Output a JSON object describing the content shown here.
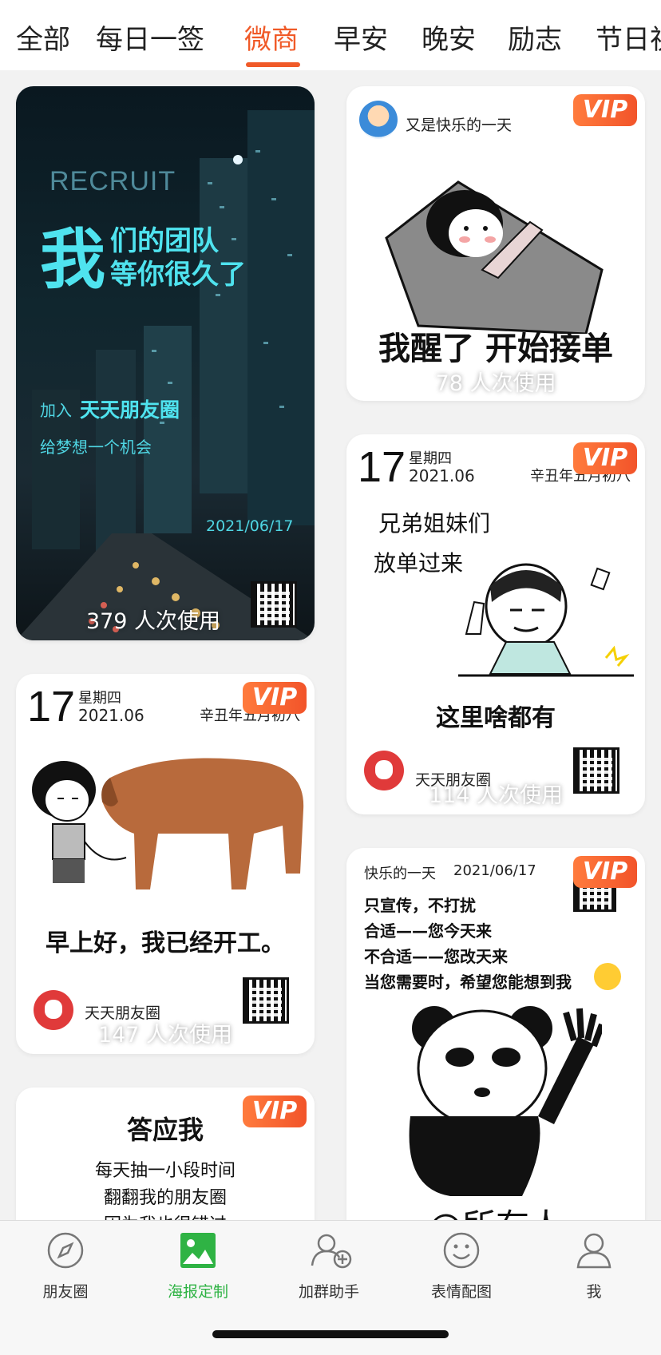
{
  "tabs": [
    "全部",
    "每日一签",
    "微商",
    "早安",
    "晚安",
    "励志",
    "节日祝"
  ],
  "active_tab_index": 2,
  "colors": {
    "accent": "#f05a28",
    "nav_active": "#2fb344",
    "vip": "#f2542a"
  },
  "cards": {
    "recruit": {
      "eyebrow": "RECRUIT",
      "headline_big": "我",
      "headline_line1": "们的团队",
      "headline_line2": "等你很久了",
      "join_prefix": "加入",
      "join_brand": "天天朋友圈",
      "tagline": "给梦想一个机会",
      "date": "2021/06/17",
      "usage": "379 人次使用"
    },
    "wakeup": {
      "vip": "VIP",
      "caption_top": "又是快乐的一天",
      "caption": "我醒了 开始接单",
      "usage": "78 人次使用"
    },
    "siblings": {
      "vip": "VIP",
      "day": "17",
      "weekday": "星期四",
      "month": "2021.06",
      "lunar": "辛丑年五月初八",
      "line1": "兄弟姐妹们",
      "line2": "放单过来",
      "caption": "这里啥都有",
      "brand": "天天朋友圈",
      "usage": "114 人次使用"
    },
    "cow": {
      "vip": "VIP",
      "day": "17",
      "weekday": "星期四",
      "month": "2021.06",
      "lunar": "辛丑年五月初八",
      "caption": "早上好，我已经开工。",
      "brand": "天天朋友圈",
      "usage": "147 人次使用"
    },
    "promise": {
      "vip": "VIP",
      "title": "答应我",
      "line1": "每天抽一小段时间",
      "line2": "翻翻我的朋友圈",
      "line3": "因为我也很错过"
    },
    "panda": {
      "vip": "VIP",
      "header_left": "快乐的一天",
      "header_date": "2021/06/17",
      "line1": "只宣传，不打扰",
      "line2": "合适——您今天来",
      "line3": "不合适——您改天来",
      "line4": "当您需要时，希望您能想到我",
      "caption": "@所有人"
    }
  },
  "nav": [
    {
      "label": "朋友圈",
      "icon": "compass-icon"
    },
    {
      "label": "海报定制",
      "icon": "image-icon",
      "active": true
    },
    {
      "label": "加群助手",
      "icon": "add-friend-icon"
    },
    {
      "label": "表情配图",
      "icon": "smile-icon"
    },
    {
      "label": "我",
      "icon": "person-icon"
    }
  ]
}
